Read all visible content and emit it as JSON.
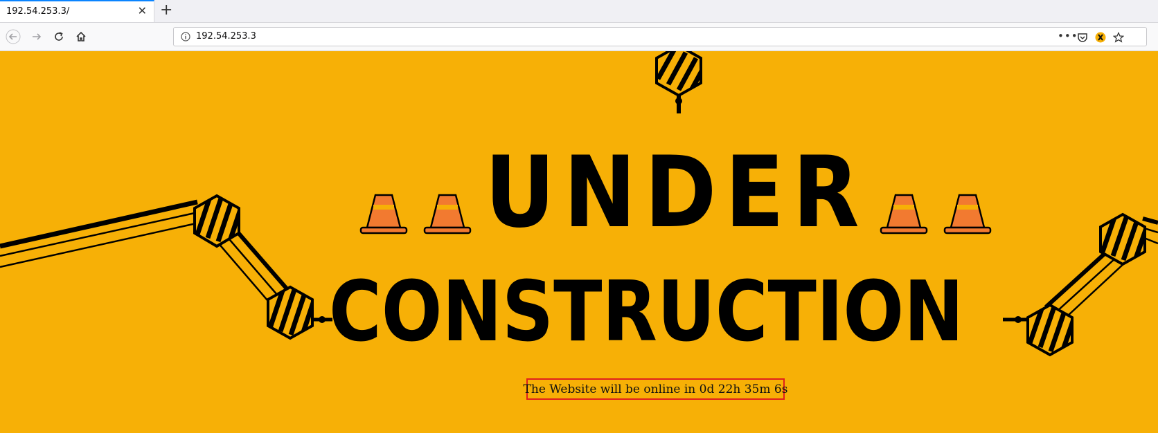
{
  "browser": {
    "tab_title": "192.54.253.3/",
    "url": "192.54.253.3"
  },
  "page": {
    "heading_word1": "UNDER",
    "heading_word2": "CONSTRUCTION",
    "countdown": "The Website will be online in 0d 22h 35m 6s",
    "colors": {
      "background": "#f7b006",
      "cone": "#f27a30",
      "border": "#e0201c"
    }
  }
}
